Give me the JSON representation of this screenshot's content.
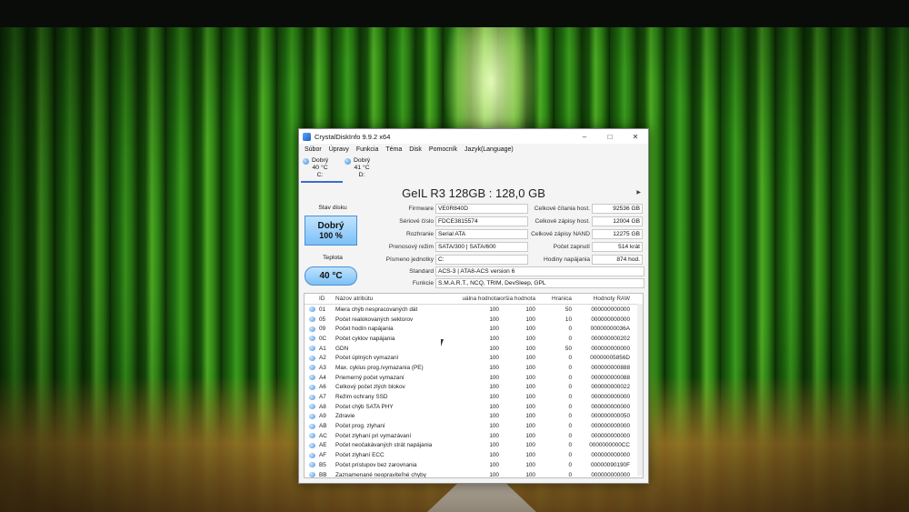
{
  "window": {
    "title": "CrystalDiskInfo 9.9.2 x64"
  },
  "window_controls": {
    "minimize": "–",
    "maximize": "□",
    "close": "✕"
  },
  "menu": [
    "Súbor",
    "Úpravy",
    "Funkcia",
    "Téma",
    "Disk",
    "Pomocník",
    "Jazyk(Language)"
  ],
  "disks": [
    {
      "status": "Dobrý",
      "temp": "40 °C",
      "letter": "C:"
    },
    {
      "status": "Dobrý",
      "temp": "41 °C",
      "letter": "D:"
    }
  ],
  "disk_title": "GeIL R3 128GB : 128,0 GB",
  "next_disk_glyph": "▶",
  "health": {
    "label": "Stav disku",
    "status": "Dobrý",
    "percent": "100 %"
  },
  "temperature": {
    "label": "Teplota",
    "value": "40 °C"
  },
  "info": {
    "firmware_label": "Firmware",
    "firmware": "VE0R840D",
    "serial_label": "Sériové číslo",
    "serial": "FDCE3815574",
    "interface_label": "Rozhranie",
    "interface": "Serial ATA",
    "transfer_label": "Prenosový režim",
    "transfer": "SATA/300 | SATA/600",
    "letters_label": "Písmeno jednotky",
    "letters": "C:",
    "standard_label": "Standard",
    "standard": "ACS-3 | ATA8-ACS version 6",
    "features_label": "Funkcie",
    "features": "S.M.A.R.T., NCQ, TRIM, DevSleep, GPL"
  },
  "stats": {
    "host_reads_label": "Celkové čítania host.",
    "host_reads": "92536 GB",
    "host_writes_label": "Celkové zápisy host.",
    "host_writes": "12004 GB",
    "nand_writes_label": "Celkové zápisy NAND",
    "nand_writes": "12275 GB",
    "power_count_label": "Počet zapnutí",
    "power_count": "514 krát",
    "power_hours_label": "Hodiny napájania",
    "power_hours": "874 hod."
  },
  "smart_headers": {
    "id": "ID",
    "name": "Názov atribútu",
    "current": "Aktuálna hodnota",
    "worst": "Najhoršia hodnota",
    "threshold": "Hranica",
    "raw": "Hodnoty RAW"
  },
  "smart_rows": [
    {
      "id": "01",
      "name": "Miera chýb nespracovaných dát",
      "cur": "100",
      "worst": "100",
      "thr": "50",
      "raw": "000000000000"
    },
    {
      "id": "05",
      "name": "Počet realokovaných sektorov",
      "cur": "100",
      "worst": "100",
      "thr": "10",
      "raw": "000000000000"
    },
    {
      "id": "09",
      "name": "Počet hodín napájania",
      "cur": "100",
      "worst": "100",
      "thr": "0",
      "raw": "00000000036A"
    },
    {
      "id": "0C",
      "name": "Počet cyklov napájania",
      "cur": "100",
      "worst": "100",
      "thr": "0",
      "raw": "000000000202"
    },
    {
      "id": "A1",
      "name": "GDN",
      "cur": "100",
      "worst": "100",
      "thr": "50",
      "raw": "000000000000"
    },
    {
      "id": "A2",
      "name": "Počet úplných vymazaní",
      "cur": "100",
      "worst": "100",
      "thr": "0",
      "raw": "00000005856D"
    },
    {
      "id": "A3",
      "name": "Max. cyklus prog./vymazania (PE)",
      "cur": "100",
      "worst": "100",
      "thr": "0",
      "raw": "000000000888"
    },
    {
      "id": "A4",
      "name": "Priemerný počet vymazaní",
      "cur": "100",
      "worst": "100",
      "thr": "0",
      "raw": "000000000088"
    },
    {
      "id": "A6",
      "name": "Celkový počet zlých blokov",
      "cur": "100",
      "worst": "100",
      "thr": "0",
      "raw": "000000000022"
    },
    {
      "id": "A7",
      "name": "Režim ochrany SSD",
      "cur": "100",
      "worst": "100",
      "thr": "0",
      "raw": "000000000000"
    },
    {
      "id": "A8",
      "name": "Počet chýb SATA PHY",
      "cur": "100",
      "worst": "100",
      "thr": "0",
      "raw": "000000000000"
    },
    {
      "id": "A9",
      "name": "Zdravie",
      "cur": "100",
      "worst": "100",
      "thr": "0",
      "raw": "000000000050"
    },
    {
      "id": "AB",
      "name": "Počet prog. zlyhaní",
      "cur": "100",
      "worst": "100",
      "thr": "0",
      "raw": "000000000000"
    },
    {
      "id": "AC",
      "name": "Počet zlyhaní pri vymazávaní",
      "cur": "100",
      "worst": "100",
      "thr": "0",
      "raw": "000000000000"
    },
    {
      "id": "AE",
      "name": "Počet neočakávaných strát napájania",
      "cur": "100",
      "worst": "100",
      "thr": "0",
      "raw": "0000000000CC"
    },
    {
      "id": "AF",
      "name": "Počet zlyhaní ECC",
      "cur": "100",
      "worst": "100",
      "thr": "0",
      "raw": "000000000000"
    },
    {
      "id": "B5",
      "name": "Počet prístupov bez zarovnania",
      "cur": "100",
      "worst": "100",
      "thr": "0",
      "raw": "00000090190F"
    },
    {
      "id": "BB",
      "name": "Zaznamenané neopraviteľné chyby",
      "cur": "100",
      "worst": "100",
      "thr": "0",
      "raw": "000000000000"
    }
  ],
  "colors": {
    "accent": "#3a88da",
    "status_box": "#7cc0f6",
    "window_bg": "#f4f4f4"
  }
}
